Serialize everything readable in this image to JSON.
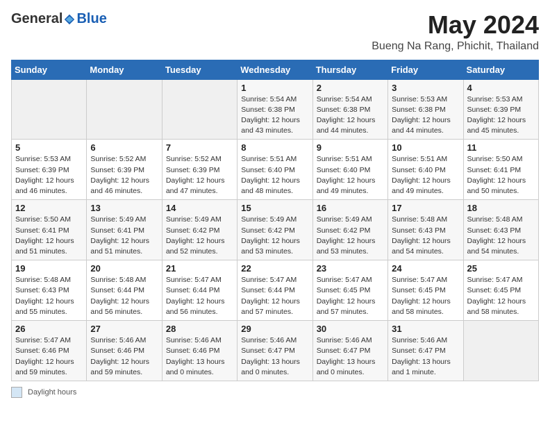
{
  "header": {
    "logo_general": "General",
    "logo_blue": "Blue",
    "month_title": "May 2024",
    "location": "Bueng Na Rang, Phichit, Thailand"
  },
  "days_of_week": [
    "Sunday",
    "Monday",
    "Tuesday",
    "Wednesday",
    "Thursday",
    "Friday",
    "Saturday"
  ],
  "legend_label": "Daylight hours",
  "weeks": [
    [
      {
        "day": "",
        "info": ""
      },
      {
        "day": "",
        "info": ""
      },
      {
        "day": "",
        "info": ""
      },
      {
        "day": "1",
        "info": "Sunrise: 5:54 AM\nSunset: 6:38 PM\nDaylight: 12 hours\nand 43 minutes."
      },
      {
        "day": "2",
        "info": "Sunrise: 5:54 AM\nSunset: 6:38 PM\nDaylight: 12 hours\nand 44 minutes."
      },
      {
        "day": "3",
        "info": "Sunrise: 5:53 AM\nSunset: 6:38 PM\nDaylight: 12 hours\nand 44 minutes."
      },
      {
        "day": "4",
        "info": "Sunrise: 5:53 AM\nSunset: 6:39 PM\nDaylight: 12 hours\nand 45 minutes."
      }
    ],
    [
      {
        "day": "5",
        "info": "Sunrise: 5:53 AM\nSunset: 6:39 PM\nDaylight: 12 hours\nand 46 minutes."
      },
      {
        "day": "6",
        "info": "Sunrise: 5:52 AM\nSunset: 6:39 PM\nDaylight: 12 hours\nand 46 minutes."
      },
      {
        "day": "7",
        "info": "Sunrise: 5:52 AM\nSunset: 6:39 PM\nDaylight: 12 hours\nand 47 minutes."
      },
      {
        "day": "8",
        "info": "Sunrise: 5:51 AM\nSunset: 6:40 PM\nDaylight: 12 hours\nand 48 minutes."
      },
      {
        "day": "9",
        "info": "Sunrise: 5:51 AM\nSunset: 6:40 PM\nDaylight: 12 hours\nand 49 minutes."
      },
      {
        "day": "10",
        "info": "Sunrise: 5:51 AM\nSunset: 6:40 PM\nDaylight: 12 hours\nand 49 minutes."
      },
      {
        "day": "11",
        "info": "Sunrise: 5:50 AM\nSunset: 6:41 PM\nDaylight: 12 hours\nand 50 minutes."
      }
    ],
    [
      {
        "day": "12",
        "info": "Sunrise: 5:50 AM\nSunset: 6:41 PM\nDaylight: 12 hours\nand 51 minutes."
      },
      {
        "day": "13",
        "info": "Sunrise: 5:49 AM\nSunset: 6:41 PM\nDaylight: 12 hours\nand 51 minutes."
      },
      {
        "day": "14",
        "info": "Sunrise: 5:49 AM\nSunset: 6:42 PM\nDaylight: 12 hours\nand 52 minutes."
      },
      {
        "day": "15",
        "info": "Sunrise: 5:49 AM\nSunset: 6:42 PM\nDaylight: 12 hours\nand 53 minutes."
      },
      {
        "day": "16",
        "info": "Sunrise: 5:49 AM\nSunset: 6:42 PM\nDaylight: 12 hours\nand 53 minutes."
      },
      {
        "day": "17",
        "info": "Sunrise: 5:48 AM\nSunset: 6:43 PM\nDaylight: 12 hours\nand 54 minutes."
      },
      {
        "day": "18",
        "info": "Sunrise: 5:48 AM\nSunset: 6:43 PM\nDaylight: 12 hours\nand 54 minutes."
      }
    ],
    [
      {
        "day": "19",
        "info": "Sunrise: 5:48 AM\nSunset: 6:43 PM\nDaylight: 12 hours\nand 55 minutes."
      },
      {
        "day": "20",
        "info": "Sunrise: 5:48 AM\nSunset: 6:44 PM\nDaylight: 12 hours\nand 56 minutes."
      },
      {
        "day": "21",
        "info": "Sunrise: 5:47 AM\nSunset: 6:44 PM\nDaylight: 12 hours\nand 56 minutes."
      },
      {
        "day": "22",
        "info": "Sunrise: 5:47 AM\nSunset: 6:44 PM\nDaylight: 12 hours\nand 57 minutes."
      },
      {
        "day": "23",
        "info": "Sunrise: 5:47 AM\nSunset: 6:45 PM\nDaylight: 12 hours\nand 57 minutes."
      },
      {
        "day": "24",
        "info": "Sunrise: 5:47 AM\nSunset: 6:45 PM\nDaylight: 12 hours\nand 58 minutes."
      },
      {
        "day": "25",
        "info": "Sunrise: 5:47 AM\nSunset: 6:45 PM\nDaylight: 12 hours\nand 58 minutes."
      }
    ],
    [
      {
        "day": "26",
        "info": "Sunrise: 5:47 AM\nSunset: 6:46 PM\nDaylight: 12 hours\nand 59 minutes."
      },
      {
        "day": "27",
        "info": "Sunrise: 5:46 AM\nSunset: 6:46 PM\nDaylight: 12 hours\nand 59 minutes."
      },
      {
        "day": "28",
        "info": "Sunrise: 5:46 AM\nSunset: 6:46 PM\nDaylight: 13 hours\nand 0 minutes."
      },
      {
        "day": "29",
        "info": "Sunrise: 5:46 AM\nSunset: 6:47 PM\nDaylight: 13 hours\nand 0 minutes."
      },
      {
        "day": "30",
        "info": "Sunrise: 5:46 AM\nSunset: 6:47 PM\nDaylight: 13 hours\nand 0 minutes."
      },
      {
        "day": "31",
        "info": "Sunrise: 5:46 AM\nSunset: 6:47 PM\nDaylight: 13 hours\nand 1 minute."
      },
      {
        "day": "",
        "info": ""
      }
    ]
  ]
}
